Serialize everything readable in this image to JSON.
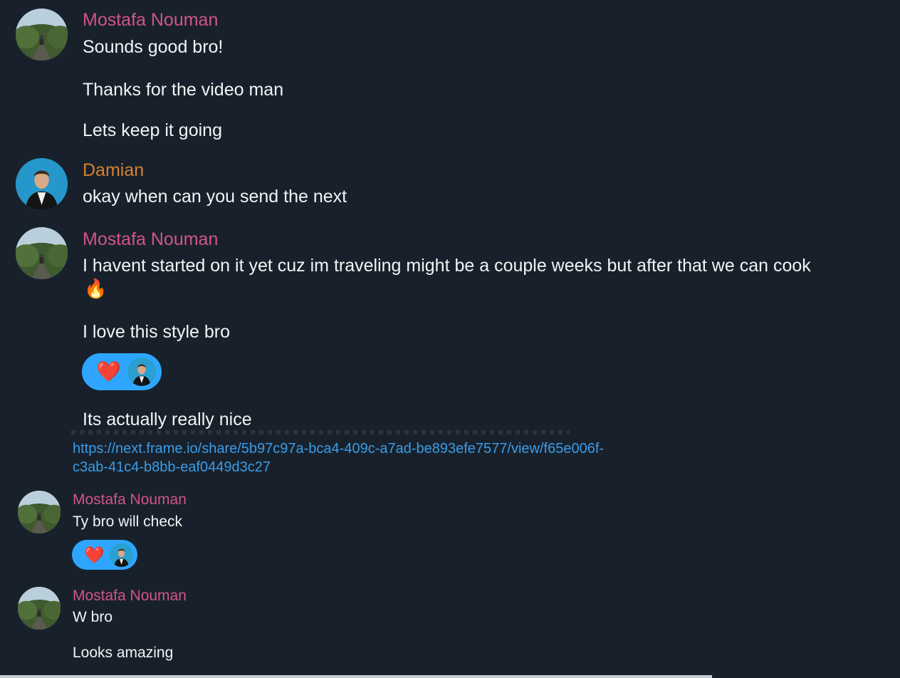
{
  "colors": {
    "background": "#18212b",
    "mostafa": "#d4528e",
    "damian": "#d7812f",
    "link": "#3a9ce8",
    "reaction_bg": "#2ea6ff"
  },
  "messages_big": [
    {
      "sender": "Mostafa Nouman",
      "lines": [
        "Sounds good bro!",
        "Thanks for the video man",
        "Lets keep it going"
      ]
    },
    {
      "sender": "Damian",
      "lines": [
        "okay when can you send the next"
      ]
    },
    {
      "sender": "Mostafa Nouman",
      "lines": [
        "I havent started on it yet cuz im traveling might be a couple weeks but after that we can cook",
        "I love this style bro",
        "Its actually really nice"
      ],
      "emoji": "🔥",
      "reaction": "❤️"
    }
  ],
  "link": {
    "line1": "https://next.frame.io/share/5b97c97a-bca4-409c-a7ad-be893efe7577/view/f65e006f-",
    "line2": "c3ab-41c4-b8bb-eaf0449d3c27"
  },
  "messages_small": [
    {
      "sender": "Mostafa Nouman",
      "lines": [
        "Ty bro will check"
      ],
      "reaction": "❤️"
    },
    {
      "sender": "Mostafa Nouman",
      "lines": [
        "W bro",
        "Looks amazing"
      ]
    }
  ]
}
